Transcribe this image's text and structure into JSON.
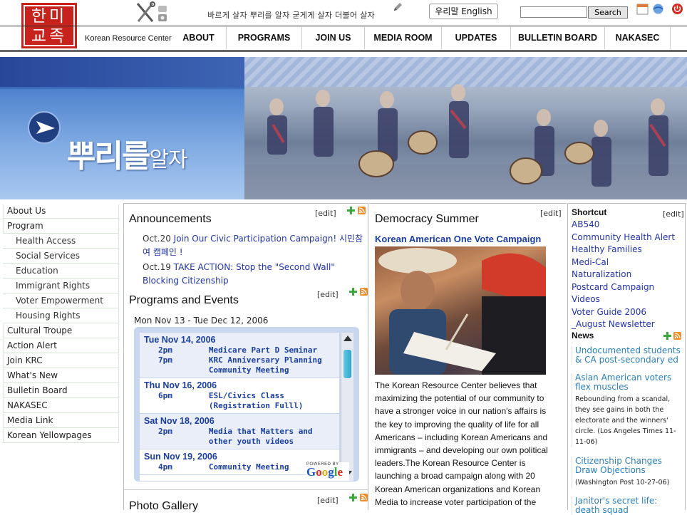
{
  "header": {
    "tagline": "바르게 살자 뿌리를 알자 굳게게 살자 더불어 살자",
    "lang_button": "우리말 English",
    "search_placeholder": "",
    "search_button": "Search",
    "org_name": "Korean Resource Center",
    "logo_text": "한미교족",
    "nav": [
      "ABOUT",
      "PROGRAMS",
      "JOIN US",
      "MEDIA ROOM",
      "UPDATES",
      "BULLETIN BOARD",
      "NAKASEC"
    ]
  },
  "banner": {
    "headline_big": "뿌리를",
    "headline_small": "알자",
    "accent": "#3d6bbb"
  },
  "left_nav": [
    {
      "label": "About Us",
      "type": "top"
    },
    {
      "label": "Program",
      "type": "top"
    },
    {
      "label": "Health Access",
      "type": "sub"
    },
    {
      "label": "Social Services",
      "type": "sub"
    },
    {
      "label": "Education",
      "type": "sub"
    },
    {
      "label": "Immigrant Rights",
      "type": "sub"
    },
    {
      "label": "Voter Empowerment",
      "type": "sub"
    },
    {
      "label": "Housing Rights",
      "type": "sub"
    },
    {
      "label": "Cultural Troupe",
      "type": "top"
    },
    {
      "label": "Action Alert",
      "type": "top"
    },
    {
      "label": "Join KRC",
      "type": "top"
    },
    {
      "label": "What's New",
      "type": "top"
    },
    {
      "label": "Bulletin Board",
      "type": "top"
    },
    {
      "label": "NAKASEC",
      "type": "top"
    },
    {
      "label": "Media Link",
      "type": "top"
    },
    {
      "label": "Korean Yellowpages",
      "type": "top"
    }
  ],
  "announcements": {
    "title": "Announcements",
    "edit": "[edit]",
    "items": [
      {
        "date": "Oct.20",
        "text": "Join Our Civic Participation Campaign! 시민참여 캠페인 !"
      },
      {
        "date": "Oct.19",
        "text": "TAKE ACTION: Stop the \"Second Wall\" Blocking Citizenship"
      }
    ]
  },
  "programs": {
    "title": "Programs and Events",
    "edit": "[edit]",
    "range": "Mon Nov 13 - Tue Dec 12, 2006",
    "days": [
      {
        "date": "Tue Nov 14, 2006",
        "events": [
          {
            "time": "2pm",
            "title": "Medicare Part D Seminar"
          },
          {
            "time": "7pm",
            "title": "KRC Anniversary Planning Community Meeting"
          }
        ]
      },
      {
        "date": "Thu Nov 16, 2006",
        "events": [
          {
            "time": "6pm",
            "title": "ESL/Civics Class (Registration Fulll)"
          }
        ]
      },
      {
        "date": "Sat Nov 18, 2006",
        "events": [
          {
            "time": "2pm",
            "title": "Media that Matters and other youth videos"
          }
        ]
      },
      {
        "date": "Sun Nov 19, 2006",
        "events": [
          {
            "time": "4pm",
            "title": "Community Meeting"
          }
        ]
      }
    ],
    "powered_label": "POWERED BY",
    "powered_logo": "Google"
  },
  "photo_gallery": {
    "title": "Photo Gallery",
    "edit": "[edit]"
  },
  "democracy": {
    "title": "Democracy Summer",
    "edit": "[edit]",
    "subtitle": "Korean American One Vote Campaign",
    "body": "The Korean Resource Center believes that maximizing the potential of our community to have a stronger voice in our nation's affairs is the key to improving the quality of life for all Americans – including Korean Americans and immigrants – and developing our own political leaders.The Korean Resource Center is launching a broad campaign along with 20 Korean American organizations and Korean Media to increase voter participation of the"
  },
  "shortcut": {
    "title": "Shortcut",
    "edit": "[edit]",
    "items": [
      "AB540",
      "Community Health Alert",
      "Healthy Families",
      "Medi-Cal",
      "Naturalization",
      "Postcard Campaign",
      "Videos",
      "Voter Guide 2006",
      "_August Newsletter"
    ]
  },
  "news": {
    "title": "News",
    "items": [
      {
        "head": "Undocumented students & CA post-secondary ed",
        "desc": ""
      },
      {
        "head": "Asian American voters flex muscles",
        "desc": "Rebounding from a scandal, they see gains in both the electorate and the winners' circle. (Los Angeles Times 11-11-06)"
      },
      {
        "head": "Citizenship Changes Draw Objections",
        "desc": "(Washington Post 10-27-06)"
      },
      {
        "head": "Janitor's secret life: death squad",
        "desc": ""
      }
    ]
  }
}
